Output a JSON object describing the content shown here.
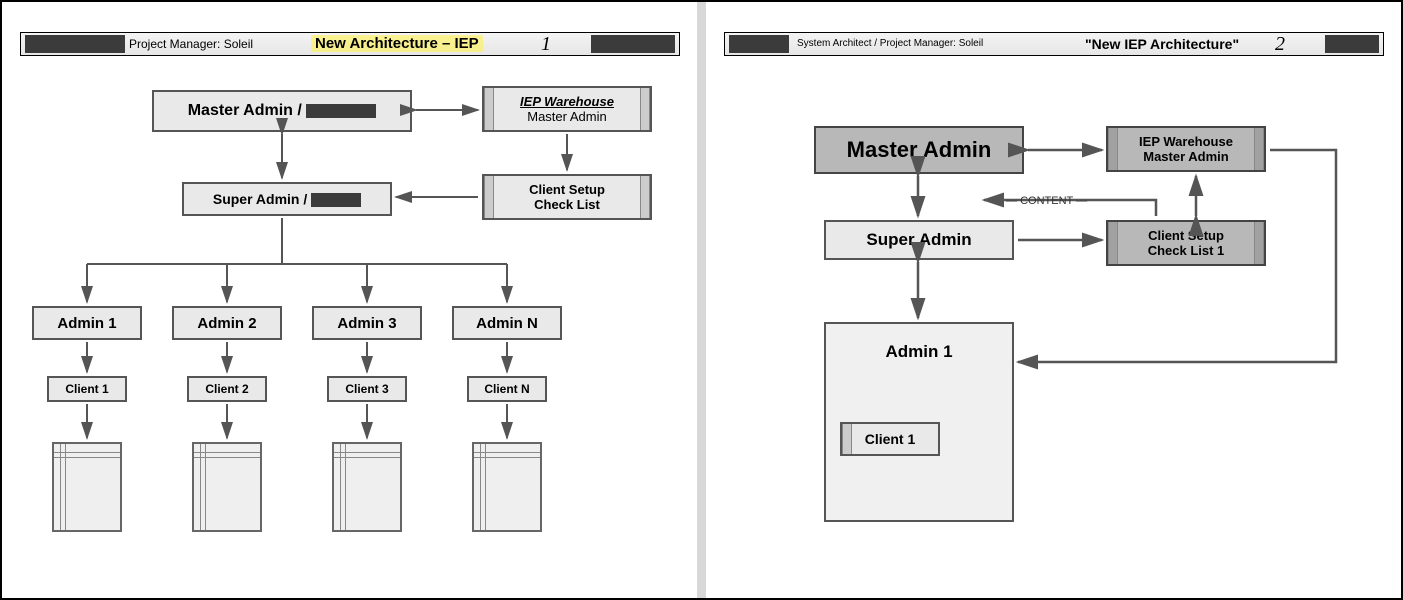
{
  "left": {
    "header": {
      "role_label": "Project Manager: Soleil",
      "title": "New Architecture – IEP",
      "page_number": "1"
    },
    "nodes": {
      "master_admin_prefix": "Master Admin /",
      "iep_warehouse_title": "IEP Warehouse",
      "iep_warehouse_sub": "Master Admin",
      "super_admin_prefix": "Super Admin /",
      "client_setup_line1": "Client Setup",
      "client_setup_line2": "Check List",
      "admins": [
        "Admin 1",
        "Admin 2",
        "Admin 3",
        "Admin N"
      ],
      "clients": [
        "Client 1",
        "Client 2",
        "Client 3",
        "Client N"
      ]
    }
  },
  "right": {
    "header": {
      "role_label": "System Architect / Project Manager: Soleil",
      "title": "\"New IEP Architecture\"",
      "page_number": "2"
    },
    "nodes": {
      "master_admin": "Master Admin",
      "iep_warehouse_line1": "IEP Warehouse",
      "iep_warehouse_line2": "Master Admin",
      "super_admin": "Super Admin",
      "content_label": "CONTENT",
      "client_setup_line1": "Client Setup",
      "client_setup_line2": "Check List 1",
      "admin1": "Admin 1",
      "client1": "Client 1"
    }
  }
}
